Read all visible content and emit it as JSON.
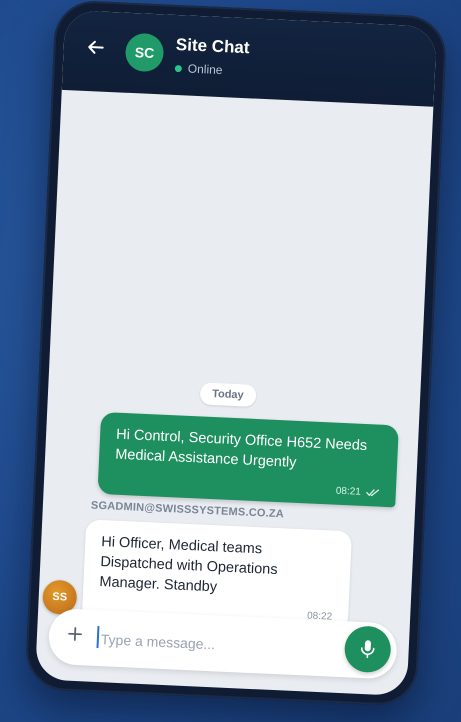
{
  "header": {
    "back_icon": "arrow-left-icon",
    "avatar_initials": "SC",
    "title": "Site Chat",
    "status": "Online"
  },
  "chat": {
    "day_label": "Today",
    "messages": [
      {
        "direction": "outgoing",
        "text": "Hi Control, Security Office H652 Needs Medical Assistance Urgently",
        "time": "08:21",
        "read_icon": "double-check-icon"
      },
      {
        "direction": "incoming",
        "sender": "SGADMIN@SWISSSYSTEMS.CO.ZA",
        "avatar_initials": "SS",
        "text": "Hi Officer, Medical teams Dispatched with Operations Manager. Standby",
        "time": "08:22"
      }
    ]
  },
  "composer": {
    "add_icon": "plus-icon",
    "placeholder": "Type a message...",
    "value": "",
    "mic_icon": "microphone-icon"
  },
  "colors": {
    "background": "#1f4b8e",
    "header": "#0f1d35",
    "accent": "#1e8f5e",
    "online": "#2bc48a",
    "incoming_avatar": "#c97b1e"
  }
}
